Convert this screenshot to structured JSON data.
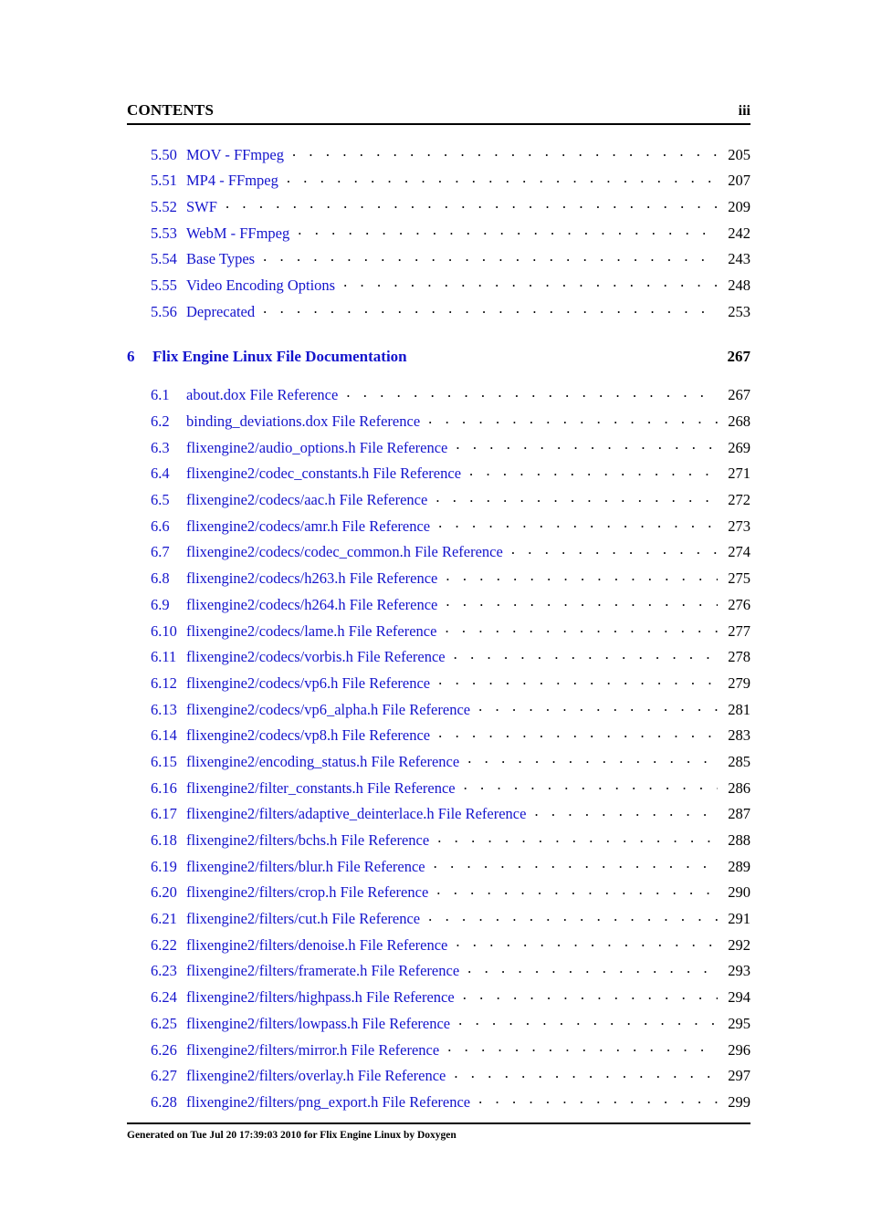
{
  "header": {
    "running_title": "CONTENTS",
    "folio": "iii"
  },
  "toc": {
    "entries": [
      {
        "level": "section",
        "number": "5.50",
        "label": "MOV - FFmpeg",
        "page": "205"
      },
      {
        "level": "section",
        "number": "5.51",
        "label": "MP4 - FFmpeg",
        "page": "207"
      },
      {
        "level": "section",
        "number": "5.52",
        "label": "SWF",
        "page": "209"
      },
      {
        "level": "section",
        "number": "5.53",
        "label": "WebM - FFmpeg",
        "page": "242"
      },
      {
        "level": "section",
        "number": "5.54",
        "label": "Base Types",
        "page": "243"
      },
      {
        "level": "section",
        "number": "5.55",
        "label": "Video Encoding Options",
        "page": "248"
      },
      {
        "level": "section",
        "number": "5.56",
        "label": "Deprecated",
        "page": "253"
      },
      {
        "level": "chapter",
        "number": "6",
        "label": "Flix Engine Linux File Documentation",
        "page": "267"
      },
      {
        "level": "section",
        "number": "6.1",
        "label": "about.dox File Reference",
        "page": "267"
      },
      {
        "level": "section",
        "number": "6.2",
        "label": "binding_deviations.dox File Reference",
        "page": "268"
      },
      {
        "level": "section",
        "number": "6.3",
        "label": "flixengine2/audio_options.h File Reference",
        "page": "269"
      },
      {
        "level": "section",
        "number": "6.4",
        "label": "flixengine2/codec_constants.h File Reference",
        "page": "271"
      },
      {
        "level": "section",
        "number": "6.5",
        "label": "flixengine2/codecs/aac.h File Reference",
        "page": "272"
      },
      {
        "level": "section",
        "number": "6.6",
        "label": "flixengine2/codecs/amr.h File Reference",
        "page": "273"
      },
      {
        "level": "section",
        "number": "6.7",
        "label": "flixengine2/codecs/codec_common.h File Reference",
        "page": "274"
      },
      {
        "level": "section",
        "number": "6.8",
        "label": "flixengine2/codecs/h263.h File Reference",
        "page": "275"
      },
      {
        "level": "section",
        "number": "6.9",
        "label": "flixengine2/codecs/h264.h File Reference",
        "page": "276"
      },
      {
        "level": "section",
        "number": "6.10",
        "label": "flixengine2/codecs/lame.h File Reference",
        "page": "277"
      },
      {
        "level": "section",
        "number": "6.11",
        "label": "flixengine2/codecs/vorbis.h File Reference",
        "page": "278"
      },
      {
        "level": "section",
        "number": "6.12",
        "label": "flixengine2/codecs/vp6.h File Reference",
        "page": "279"
      },
      {
        "level": "section",
        "number": "6.13",
        "label": "flixengine2/codecs/vp6_alpha.h File Reference",
        "page": "281"
      },
      {
        "level": "section",
        "number": "6.14",
        "label": "flixengine2/codecs/vp8.h File Reference",
        "page": "283"
      },
      {
        "level": "section",
        "number": "6.15",
        "label": "flixengine2/encoding_status.h File Reference",
        "page": "285"
      },
      {
        "level": "section",
        "number": "6.16",
        "label": "flixengine2/filter_constants.h File Reference",
        "page": "286"
      },
      {
        "level": "section",
        "number": "6.17",
        "label": "flixengine2/filters/adaptive_deinterlace.h File Reference",
        "page": "287"
      },
      {
        "level": "section",
        "number": "6.18",
        "label": "flixengine2/filters/bchs.h File Reference",
        "page": "288"
      },
      {
        "level": "section",
        "number": "6.19",
        "label": "flixengine2/filters/blur.h File Reference",
        "page": "289"
      },
      {
        "level": "section",
        "number": "6.20",
        "label": "flixengine2/filters/crop.h File Reference",
        "page": "290"
      },
      {
        "level": "section",
        "number": "6.21",
        "label": "flixengine2/filters/cut.h File Reference",
        "page": "291"
      },
      {
        "level": "section",
        "number": "6.22",
        "label": "flixengine2/filters/denoise.h File Reference",
        "page": "292"
      },
      {
        "level": "section",
        "number": "6.23",
        "label": "flixengine2/filters/framerate.h File Reference",
        "page": "293"
      },
      {
        "level": "section",
        "number": "6.24",
        "label": "flixengine2/filters/highpass.h File Reference",
        "page": "294"
      },
      {
        "level": "section",
        "number": "6.25",
        "label": "flixengine2/filters/lowpass.h File Reference",
        "page": "295"
      },
      {
        "level": "section",
        "number": "6.26",
        "label": "flixengine2/filters/mirror.h File Reference",
        "page": "296"
      },
      {
        "level": "section",
        "number": "6.27",
        "label": "flixengine2/filters/overlay.h File Reference",
        "page": "297"
      },
      {
        "level": "section",
        "number": "6.28",
        "label": "flixengine2/filters/png_export.h File Reference",
        "page": "299"
      }
    ]
  },
  "footer": {
    "text": "Generated on Tue Jul 20 17:39:03 2010 for Flix Engine Linux by Doxygen"
  },
  "colors": {
    "link": "#1414cc",
    "text": "#000000",
    "background": "#ffffff"
  }
}
